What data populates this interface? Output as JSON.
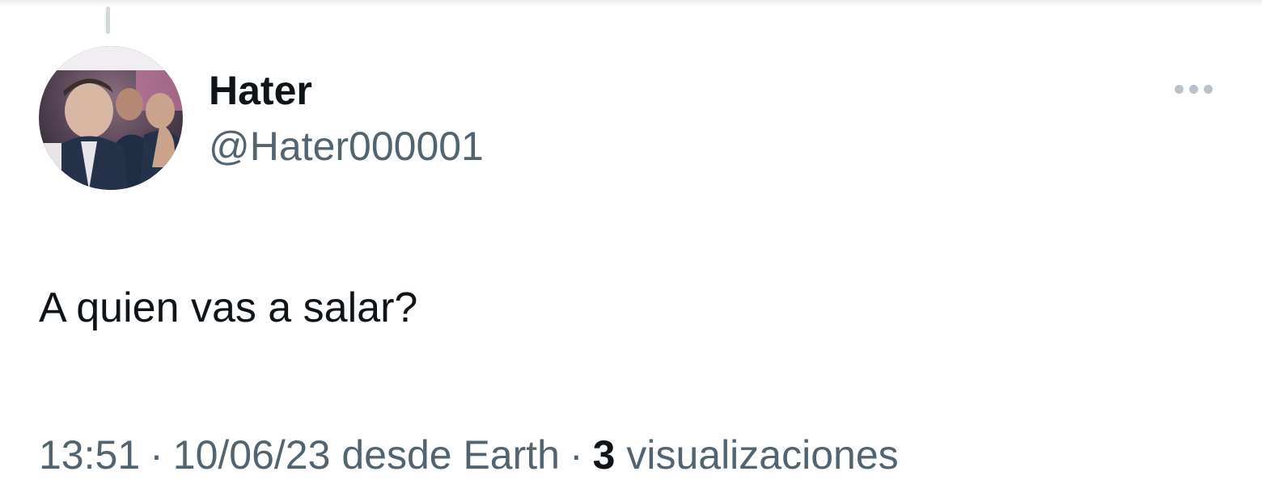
{
  "tweet": {
    "author": {
      "display_name": "Hater",
      "handle": "@Hater000001"
    },
    "text": "A quien vas a salar?",
    "meta": {
      "time": "13:51",
      "separator": "·",
      "date": "10/06/23",
      "source": "desde Earth",
      "views_count": "3",
      "views_label": "visualizaciones"
    },
    "more_menu_icon": "ellipsis-icon"
  },
  "colors": {
    "text_primary": "#0f1419",
    "text_secondary": "#536471",
    "thread_line": "#cfd9de",
    "more_dots": "#b9c2ca",
    "background": "#ffffff"
  }
}
